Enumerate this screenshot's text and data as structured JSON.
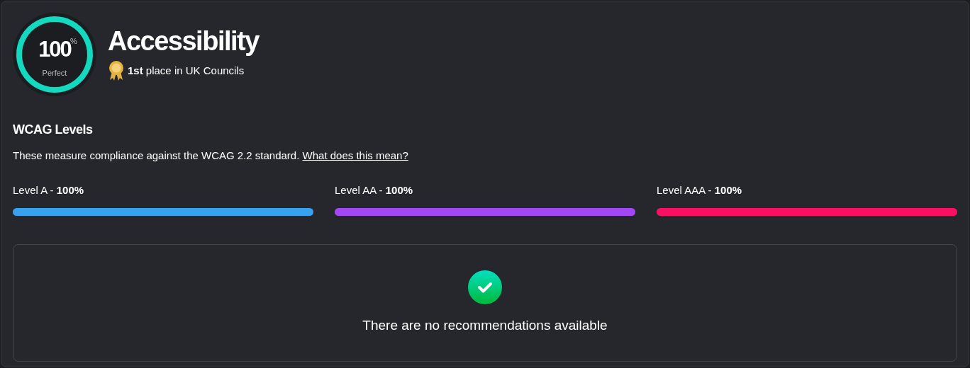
{
  "score": {
    "value": "100",
    "unit": "%",
    "label": "Perfect"
  },
  "title": "Accessibility",
  "ranking": "**1st** place in UK Councils",
  "wcag": {
    "heading": "WCAG Levels",
    "description": "These measure compliance against the WCAG 2.2 standard.",
    "link": "What does this mean?",
    "levels": [
      {
        "label": "Level A - **100%**",
        "level": 1,
        "color": "#36a2f0"
      },
      {
        "label": "Level AA - **100%**",
        "level": 1,
        "color": "#a347f5"
      },
      {
        "label": "Level AAA - **100%**",
        "level": 1,
        "color": "#fb0f63"
      }
    ]
  },
  "recommendations": {
    "message": "There are no recommendations available"
  }
}
